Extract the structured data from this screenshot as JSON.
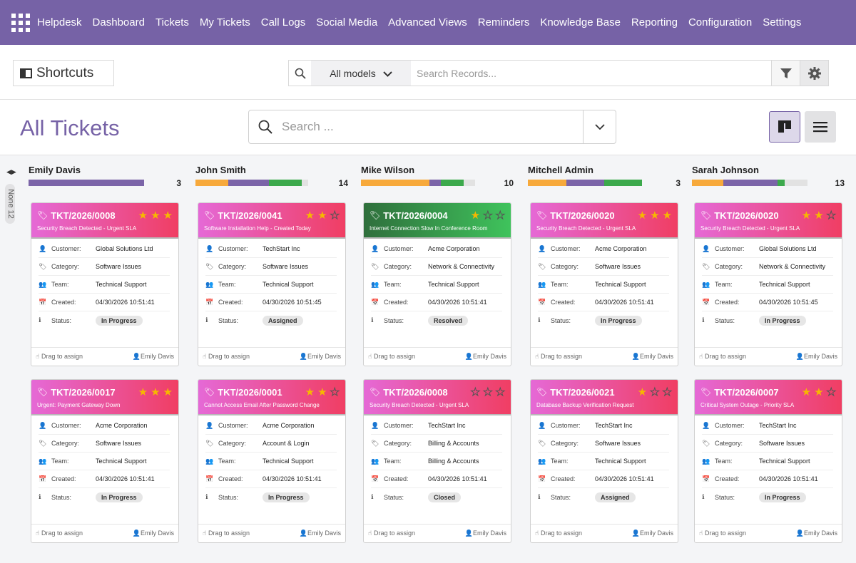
{
  "nav": {
    "brand": "Helpdesk",
    "items": [
      "Dashboard",
      "Tickets",
      "My Tickets",
      "Call Logs",
      "Social Media",
      "Advanced Views",
      "Reminders",
      "Knowledge Base",
      "Reporting",
      "Configuration",
      "Settings"
    ]
  },
  "toolbar": {
    "shortcuts": "Shortcuts",
    "models": "All models",
    "search_placeholder": "Search Records..."
  },
  "page": {
    "title": "All Tickets",
    "search_placeholder": "Search ..."
  },
  "fold": {
    "label": "None",
    "count": "12"
  },
  "labels": {
    "customer": "Customer:",
    "category": "Category:",
    "team": "Team:",
    "created": "Created:",
    "status": "Status:",
    "drag": "Drag to assign"
  },
  "colors": {
    "accent": "#7662a6",
    "pink_gradient": [
      "#e569d6",
      "#f03e63"
    ],
    "green": "#3ca94c",
    "progress": [
      "#f7a93b",
      "#7b64a8",
      "#3ca94c",
      "#e2e2e2"
    ]
  },
  "columns": [
    {
      "name": "Emily Davis",
      "count": "3",
      "progress": [
        0,
        1,
        0,
        0
      ],
      "cards": [
        {
          "number": "TKT/2026/0008",
          "stars": 3,
          "title": "Security Breach Detected - Urgent SLA",
          "color": "pink",
          "customer": "Global Solutions Ltd",
          "category": "Software Issues",
          "team": "Technical Support",
          "created": "04/30/2026 10:51:41",
          "status": "In Progress",
          "user": "Emily Davis"
        },
        {
          "number": "TKT/2026/0017",
          "stars": 3,
          "title": "Urgent: Payment Gateway Down",
          "color": "pink",
          "customer": "Acme Corporation",
          "category": "Software Issues",
          "team": "Technical Support",
          "created": "04/30/2026 10:51:41",
          "status": "In Progress",
          "user": "Emily Davis"
        }
      ]
    },
    {
      "name": "John Smith",
      "count": "14",
      "progress": [
        0.29,
        0.36,
        0.29,
        0.06
      ],
      "cards": [
        {
          "number": "TKT/2026/0041",
          "stars": 2,
          "title": "Software Installation Help - Created Today",
          "color": "pink",
          "customer": "TechStart Inc",
          "category": " Software Issues",
          "team": "Technical Support",
          "created": "04/30/2026 10:51:45",
          "status": "Assigned",
          "user": "Emily Davis"
        },
        {
          "number": "TKT/2026/0001",
          "stars": 2,
          "title": "Cannot Access Email After Password Change",
          "color": "pink",
          "customer": "Acme Corporation",
          "category": "Account & Login",
          "team": "Technical Support",
          "created": "04/30/2026 10:51:41",
          "status": "In Progress",
          "user": "Emily Davis"
        }
      ]
    },
    {
      "name": "Mike Wilson",
      "count": "10",
      "progress": [
        0.6,
        0.1,
        0.2,
        0.1
      ],
      "cards": [
        {
          "number": "TKT/2026/0004",
          "stars": 1,
          "title": "Internet Connection Slow In Conference Room",
          "color": "green",
          "customer": "Acme Corporation",
          "category": "Network & Connectivity",
          "team": "Technical Support",
          "created": "04/30/2026 10:51:41",
          "status": "Resolved",
          "user": "Emily Davis"
        },
        {
          "number": "TKT/2026/0008",
          "stars": 0,
          "title": "Security Breach Detected - Urgent SLA",
          "color": "pink",
          "customer": "TechStart Inc",
          "category": "Billing & Accounts",
          "team": "Billing & Accounts",
          "created": "04/30/2026 10:51:41",
          "status": "Closed",
          "user": "Emily Davis"
        }
      ]
    },
    {
      "name": "Mitchell Admin",
      "count": "3",
      "progress": [
        0.34,
        0.33,
        0.33,
        0
      ],
      "cards": [
        {
          "number": "TKT/2026/0020",
          "stars": 3,
          "title": "Security Breach Detected - Urgent SLA",
          "color": "pink",
          "customer": "Acme Corporation",
          "category": " Software Issues",
          "team": "Technical Support",
          "created": "04/30/2026 10:51:41",
          "status": "In Progress",
          "user": "Emily Davis"
        },
        {
          "number": "TKT/2026/0021",
          "stars": 1,
          "title": "Database Backup Verification Request",
          "color": "pink",
          "customer": "TechStart Inc",
          "category": "Software Issues",
          "team": "Technical Support",
          "created": "04/30/2026 10:51:41",
          "status": "Assigned",
          "user": "Emily Davis"
        }
      ]
    },
    {
      "name": "Sarah Johnson",
      "count": "13",
      "progress": [
        0.27,
        0.47,
        0.06,
        0.2
      ],
      "cards": [
        {
          "number": "TKT/2026/0020",
          "stars": 2,
          "title": "Security Breach Detected - Urgent SLA",
          "color": "pink",
          "customer": "Global Solutions Ltd",
          "category": "Network & Connectivity",
          "team": "Technical Support",
          "created": "04/30/2026 10:51:45",
          "status": "In Progress",
          "user": "Emily Davis"
        },
        {
          "number": "TKT/2026/0007",
          "stars": 2,
          "title": "Critical System Outage - Priority SLA",
          "color": "pink",
          "customer": "TechStart Inc",
          "category": " Software Issues",
          "team": "Technical Support",
          "created": "04/30/2026 10:51:41",
          "status": "In Progress",
          "user": "Emily Davis"
        }
      ]
    }
  ]
}
